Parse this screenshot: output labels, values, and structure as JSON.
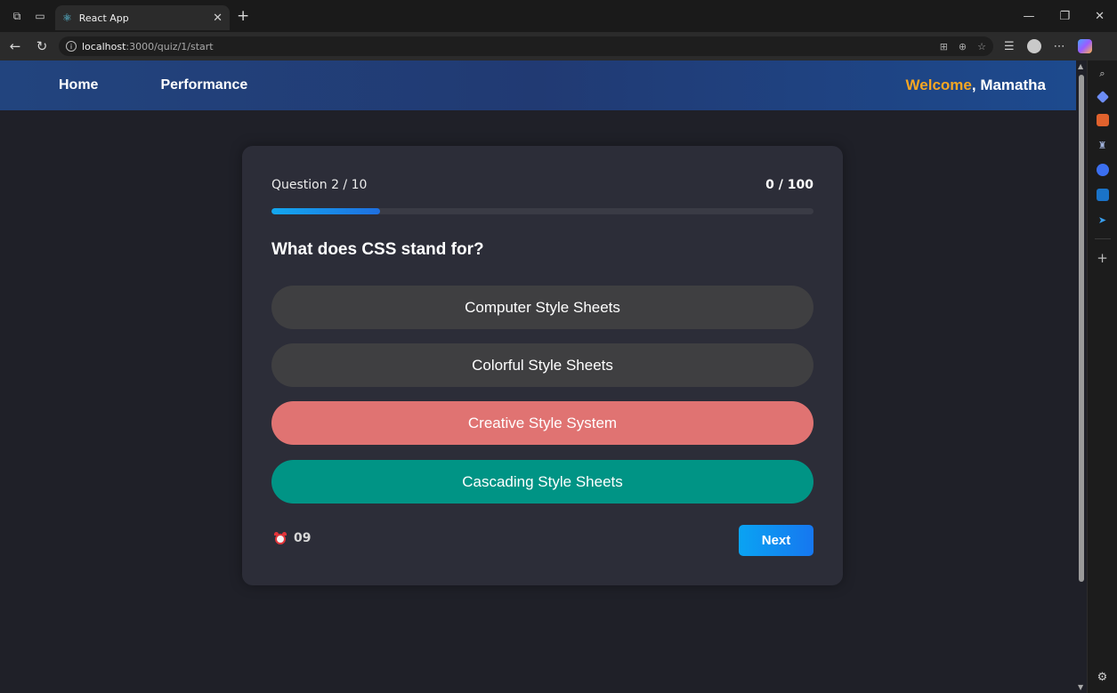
{
  "browser": {
    "tab_title": "React App",
    "url_host": "localhost",
    "url_path": ":3000/quiz/1/start"
  },
  "header": {
    "nav": [
      {
        "label": "Home"
      },
      {
        "label": "Performance"
      }
    ],
    "welcome_word": "Welcome",
    "welcome_sep": ", ",
    "user_name": "Mamatha"
  },
  "quiz": {
    "question_counter": "Question 2 / 10",
    "score": "0 / 100",
    "progress": 0.2,
    "question": "What does CSS stand for?",
    "options": [
      {
        "label": "Computer Style Sheets",
        "state": "neutral"
      },
      {
        "label": "Colorful Style Sheets",
        "state": "neutral"
      },
      {
        "label": "Creative Style System",
        "state": "wrong"
      },
      {
        "label": "Cascading Style Sheets",
        "state": "correct"
      }
    ],
    "timer": "09",
    "next_label": "Next"
  },
  "colors": {
    "header_bg": "#22447e",
    "welcome_accent": "#f5a623",
    "wrong": "#e07372",
    "correct": "#009485",
    "neutral": "#3f3f41",
    "next_button": "#0aa3f2"
  }
}
